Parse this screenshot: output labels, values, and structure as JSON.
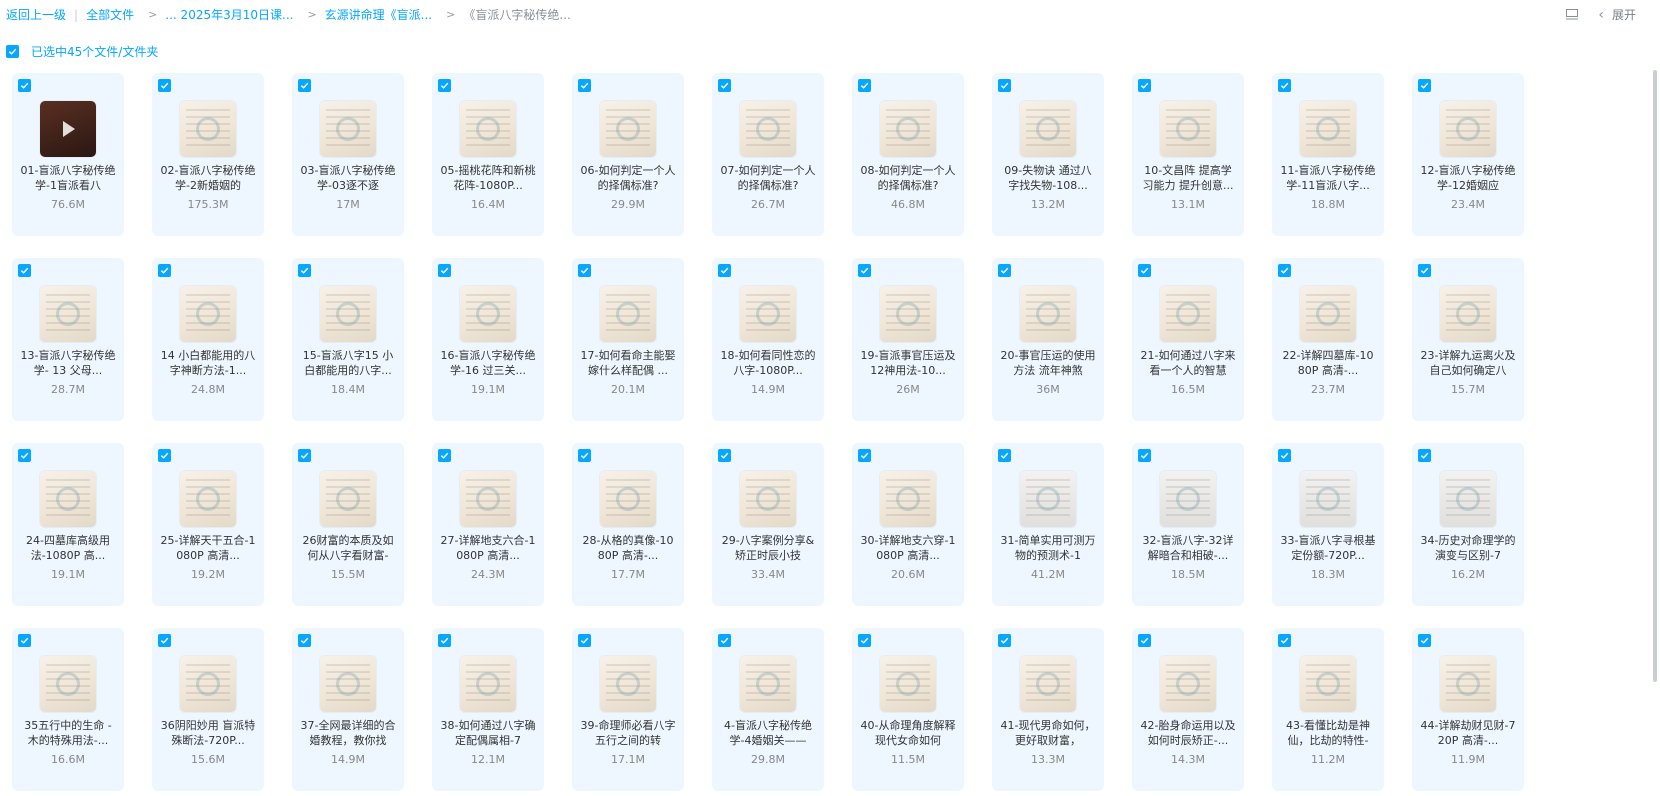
{
  "breadcrumb": {
    "back": "返回上一级",
    "all_files": "全部文件",
    "crumb1": "... 2025年3月10日课...",
    "crumb2": "玄源讲命理《盲派...",
    "current": "《盲派八字秘传绝..."
  },
  "toolbar": {
    "expand_label": "展开"
  },
  "selection": {
    "label": "已选中45个文件/文件夹",
    "all_checked": true
  },
  "colors": {
    "accent": "#06a7ff",
    "card_bg": "#eef7ff"
  },
  "files": [
    {
      "name": "01-盲派八字秘传绝学-1盲派看八",
      "size": "76.6M",
      "thumb": "dark"
    },
    {
      "name": "02-盲派八字秘传绝学-2新婚姻的",
      "size": "175.3M",
      "thumb": "doc"
    },
    {
      "name": "03-盲派八字秘传绝学-03逐不逐",
      "size": "17M",
      "thumb": "doc"
    },
    {
      "name": "05-摇桃花阵和新桃花阵-1080P...",
      "size": "16.4M",
      "thumb": "doc"
    },
    {
      "name": "06-如何判定一个人的择偶标准?",
      "size": "29.9M",
      "thumb": "doc"
    },
    {
      "name": "07-如何判定一个人的择偶标准?",
      "size": "26.7M",
      "thumb": "doc"
    },
    {
      "name": "08-如何判定一个人的择偶标准?",
      "size": "46.8M",
      "thumb": "doc"
    },
    {
      "name": "09-失物诀 通过八字找失物-108...",
      "size": "13.2M",
      "thumb": "doc"
    },
    {
      "name": "10-文昌阵 提高学习能力 提升创意...",
      "size": "13.1M",
      "thumb": "doc"
    },
    {
      "name": "11-盲派八字秘传绝学-11盲派八字...",
      "size": "18.8M",
      "thumb": "doc"
    },
    {
      "name": "12-盲派八字秘传绝学-12婚姻应",
      "size": "23.4M",
      "thumb": "doc"
    },
    {
      "name": "13-盲派八字秘传绝学- 13 父母...",
      "size": "28.7M",
      "thumb": "doc"
    },
    {
      "name": "14 小白都能用的八字神断方法-1...",
      "size": "24.8M",
      "thumb": "doc"
    },
    {
      "name": "15-盲派八字15 小白都能用的八字...",
      "size": "18.4M",
      "thumb": "doc"
    },
    {
      "name": "16-盲派八字秘传绝学-16 过三关...",
      "size": "19.1M",
      "thumb": "doc"
    },
    {
      "name": "17-如何看命主能娶嫁什么样配偶 ...",
      "size": "20.1M",
      "thumb": "doc"
    },
    {
      "name": "18-如何看同性恋的八字-1080P...",
      "size": "14.9M",
      "thumb": "doc"
    },
    {
      "name": "19-盲派事官压运及12神用法-10...",
      "size": "26M",
      "thumb": "doc"
    },
    {
      "name": "20-事官压运的使用方法 流年神煞",
      "size": "36M",
      "thumb": "doc"
    },
    {
      "name": "21-如何通过八字来看一个人的智慧",
      "size": "16.5M",
      "thumb": "doc"
    },
    {
      "name": "22-详解四墓库-1080P 高清-...",
      "size": "23.7M",
      "thumb": "doc"
    },
    {
      "name": "23-详解九运离火及自己如何确定八",
      "size": "15.7M",
      "thumb": "doc"
    },
    {
      "name": "24-四墓库高级用法-1080P 高...",
      "size": "19.1M",
      "thumb": "doc"
    },
    {
      "name": "25-详解天干五合-1080P 高清...",
      "size": "19.2M",
      "thumb": "doc"
    },
    {
      "name": "26财富的本质及如何从八字看财富-",
      "size": "15.5M",
      "thumb": "doc"
    },
    {
      "name": "27-详解地支六合-1080P 高清...",
      "size": "24.3M",
      "thumb": "doc"
    },
    {
      "name": "28-从格的真像-1080P 高清-...",
      "size": "17.7M",
      "thumb": "doc"
    },
    {
      "name": "29-八字案例分享&矫正时辰小技",
      "size": "33.4M",
      "thumb": "doc"
    },
    {
      "name": "30-详解地支六穿-1080P 高清...",
      "size": "20.6M",
      "thumb": "doc"
    },
    {
      "name": "31-简单实用可测万物的预测术-1",
      "size": "41.2M",
      "thumb": "gray"
    },
    {
      "name": "32-盲派八字-32详解暗合和相破-...",
      "size": "18.5M",
      "thumb": "gray"
    },
    {
      "name": "33-盲派八字寻根基定份额-720P...",
      "size": "18.3M",
      "thumb": "gray"
    },
    {
      "name": "34-历史对命理学的演变与区别-7",
      "size": "16.2M",
      "thumb": "gray"
    },
    {
      "name": "35五行中的生命 -木的特殊用法-...",
      "size": "16.6M",
      "thumb": "doc"
    },
    {
      "name": "36阴阳妙用 盲派特殊断法-720P...",
      "size": "15.6M",
      "thumb": "doc"
    },
    {
      "name": "37-全网最详细的合婚教程，教你找",
      "size": "14.9M",
      "thumb": "doc"
    },
    {
      "name": "38-如何通过八字确定配偶属相-7",
      "size": "12.1M",
      "thumb": "doc"
    },
    {
      "name": "39-命理师必看八字五行之间的转",
      "size": "17.1M",
      "thumb": "doc"
    },
    {
      "name": "4-盲派八字秘传绝学-4婚姻关——",
      "size": "29.8M",
      "thumb": "doc"
    },
    {
      "name": "40-从命理角度解释 现代女命如何",
      "size": "11.5M",
      "thumb": "doc"
    },
    {
      "name": "41-现代男命如何，更好取财富，",
      "size": "13.3M",
      "thumb": "doc"
    },
    {
      "name": "42-胎身命运用以及如何时辰矫正-...",
      "size": "14.3M",
      "thumb": "doc"
    },
    {
      "name": "43-看懂比劫是神仙，比劫的特性-",
      "size": "11.2M",
      "thumb": "doc"
    },
    {
      "name": "44-详解劫财见财-720P 高清-...",
      "size": "11.9M",
      "thumb": "doc"
    }
  ]
}
